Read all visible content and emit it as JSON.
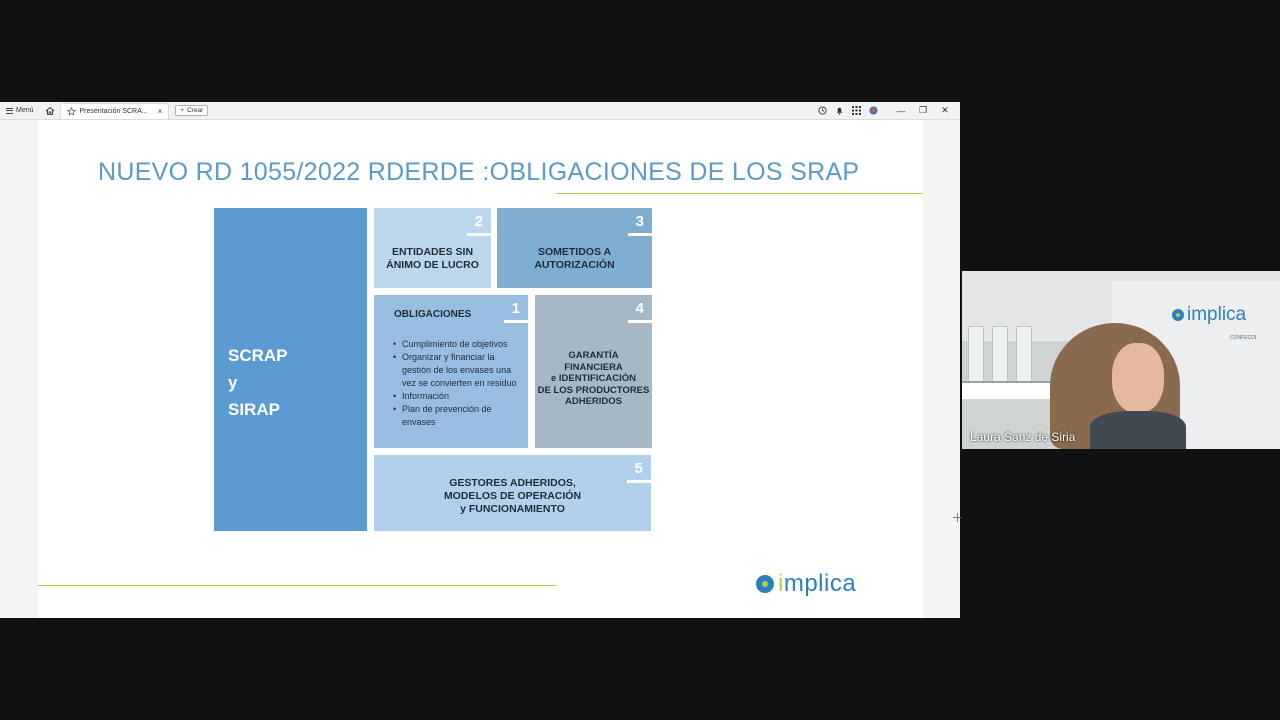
{
  "browser": {
    "menu_label": "Menú",
    "tab_title": "Presentación SCRA...",
    "tab_close": "×",
    "new_label": "Crear",
    "new_plus": "+",
    "window_controls": {
      "minimize": "—",
      "restore": "❐",
      "close": "✕"
    }
  },
  "slide": {
    "title": "NUEVO RD 1055/2022 RDERDE :OBLIGACIONES DE LOS SRAP",
    "big_box": {
      "line1": "SCRAP",
      "line2": "y",
      "line3": "SIRAP"
    },
    "box2": {
      "num": "2",
      "line1": "ENTIDADES SIN",
      "line2": "ÁNIMO DE LUCRO"
    },
    "box3": {
      "num": "3",
      "line1": "SOMETIDOS A",
      "line2": "AUTORIZACIÓN"
    },
    "box1": {
      "num": "1",
      "title": "OBLIGACIONES",
      "items": [
        "Cumplimiento de objetivos",
        "Organizar y financiar la gestión de los envases una vez se convierten en residuo",
        "Información",
        "Plan de prevención de envases"
      ]
    },
    "box4": {
      "num": "4",
      "line1": "GARANTÍA",
      "line2": "FINANCIERA",
      "line3": "e IDENTIFICACIÓN",
      "line4": "DE LOS PRODUCTORES",
      "line5": "ADHERIDOS"
    },
    "box5": {
      "num": "5",
      "line1": "GESTORES ADHERIDOS,",
      "line2": "MODELOS DE OPERACIÓN",
      "line3": "y FUNCIONAMIENTO"
    },
    "logo_text_a": "i",
    "logo_text_b": "mplica",
    "accent_color": "#b5cf3f",
    "brand_color": "#2d7fc0"
  },
  "webcam": {
    "participant_name": "Laura Sanz de Siria",
    "logo_text": "implica",
    "logo_sub": "CONFECOI"
  }
}
